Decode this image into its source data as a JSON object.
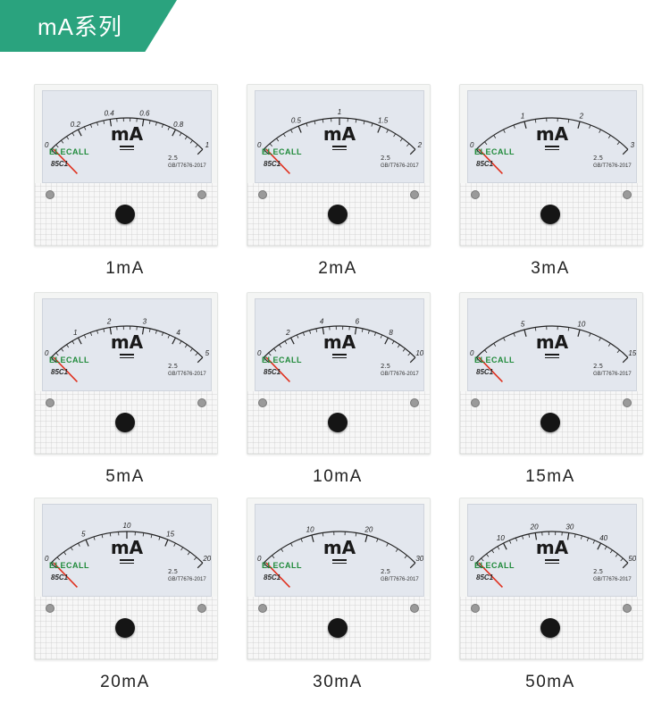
{
  "banner": {
    "title": "mA系列",
    "color": "#2aa37e"
  },
  "meters": [
    {
      "caption": "1mA",
      "unit": "mA",
      "brand": "ELECALL",
      "model": "85C1",
      "class_mark": "2.5",
      "standard": "GB/T7676-2017",
      "scale_labels": [
        "0",
        "0.2",
        "0.4",
        "0.6",
        "0.8",
        "1"
      ]
    },
    {
      "caption": "2mA",
      "unit": "mA",
      "brand": "ELECALL",
      "model": "85C1",
      "class_mark": "2.5",
      "standard": "GB/T7676-2017",
      "scale_labels": [
        "0",
        "0.5",
        "1",
        "1.5",
        "2"
      ]
    },
    {
      "caption": "3mA",
      "unit": "mA",
      "brand": "ELECALL",
      "model": "85C1",
      "class_mark": "2.5",
      "standard": "GB/T7676-2017",
      "scale_labels": [
        "0",
        "1",
        "2",
        "3"
      ]
    },
    {
      "caption": "5mA",
      "unit": "mA",
      "brand": "ELECALL",
      "model": "85C1",
      "class_mark": "2.5",
      "standard": "GB/T7676-2017",
      "scale_labels": [
        "0",
        "1",
        "2",
        "3",
        "4",
        "5"
      ]
    },
    {
      "caption": "10mA",
      "unit": "mA",
      "brand": "ELECALL",
      "model": "85C1",
      "class_mark": "2.5",
      "standard": "GB/T7676-2017",
      "scale_labels": [
        "0",
        "2",
        "4",
        "6",
        "8",
        "10"
      ]
    },
    {
      "caption": "15mA",
      "unit": "mA",
      "brand": "ELECALL",
      "model": "85C1",
      "class_mark": "2.5",
      "standard": "GB/T7676-2017",
      "scale_labels": [
        "0",
        "5",
        "10",
        "15"
      ]
    },
    {
      "caption": "20mA",
      "unit": "mA",
      "brand": "ELECALL",
      "model": "85C1",
      "class_mark": "2.5",
      "standard": "GB/T7676-2017",
      "scale_labels": [
        "0",
        "5",
        "10",
        "15",
        "20"
      ]
    },
    {
      "caption": "30mA",
      "unit": "mA",
      "brand": "ELECALL",
      "model": "85C1",
      "class_mark": "2.5",
      "standard": "GB/T7676-2017",
      "scale_labels": [
        "0",
        "10",
        "20",
        "30"
      ]
    },
    {
      "caption": "50mA",
      "unit": "mA",
      "brand": "ELECALL",
      "model": "85C1",
      "class_mark": "2.5",
      "standard": "GB/T7676-2017",
      "scale_labels": [
        "0",
        "10",
        "20",
        "30",
        "40",
        "50"
      ]
    }
  ],
  "colors": {
    "needle": "#e0301e",
    "dial_face": "#e3e7ee",
    "brand_text": "#1f8a3a"
  }
}
